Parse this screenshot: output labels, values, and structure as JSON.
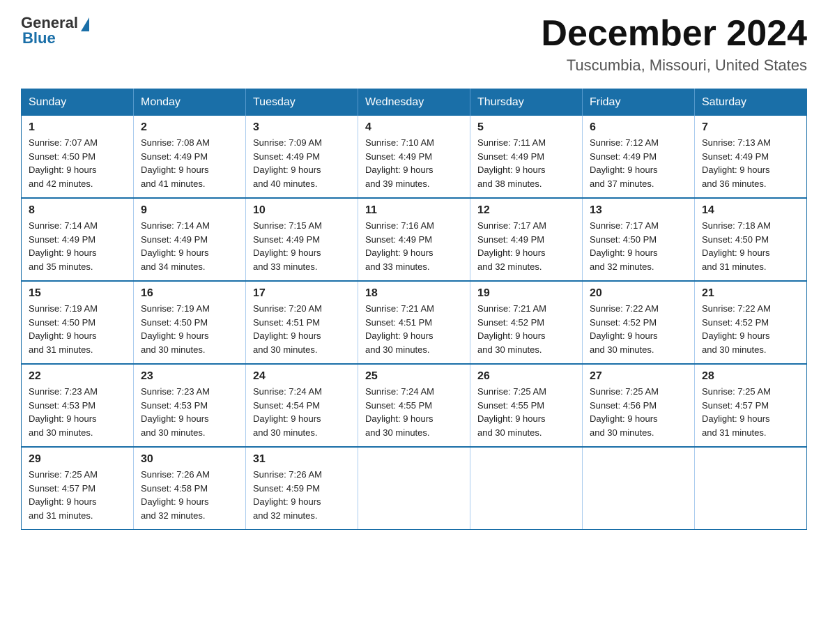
{
  "header": {
    "logo_general": "General",
    "logo_blue": "Blue",
    "month_title": "December 2024",
    "location": "Tuscumbia, Missouri, United States"
  },
  "weekdays": [
    "Sunday",
    "Monday",
    "Tuesday",
    "Wednesday",
    "Thursday",
    "Friday",
    "Saturday"
  ],
  "weeks": [
    [
      {
        "day": "1",
        "sunrise": "7:07 AM",
        "sunset": "4:50 PM",
        "daylight": "9 hours and 42 minutes."
      },
      {
        "day": "2",
        "sunrise": "7:08 AM",
        "sunset": "4:49 PM",
        "daylight": "9 hours and 41 minutes."
      },
      {
        "day": "3",
        "sunrise": "7:09 AM",
        "sunset": "4:49 PM",
        "daylight": "9 hours and 40 minutes."
      },
      {
        "day": "4",
        "sunrise": "7:10 AM",
        "sunset": "4:49 PM",
        "daylight": "9 hours and 39 minutes."
      },
      {
        "day": "5",
        "sunrise": "7:11 AM",
        "sunset": "4:49 PM",
        "daylight": "9 hours and 38 minutes."
      },
      {
        "day": "6",
        "sunrise": "7:12 AM",
        "sunset": "4:49 PM",
        "daylight": "9 hours and 37 minutes."
      },
      {
        "day": "7",
        "sunrise": "7:13 AM",
        "sunset": "4:49 PM",
        "daylight": "9 hours and 36 minutes."
      }
    ],
    [
      {
        "day": "8",
        "sunrise": "7:14 AM",
        "sunset": "4:49 PM",
        "daylight": "9 hours and 35 minutes."
      },
      {
        "day": "9",
        "sunrise": "7:14 AM",
        "sunset": "4:49 PM",
        "daylight": "9 hours and 34 minutes."
      },
      {
        "day": "10",
        "sunrise": "7:15 AM",
        "sunset": "4:49 PM",
        "daylight": "9 hours and 33 minutes."
      },
      {
        "day": "11",
        "sunrise": "7:16 AM",
        "sunset": "4:49 PM",
        "daylight": "9 hours and 33 minutes."
      },
      {
        "day": "12",
        "sunrise": "7:17 AM",
        "sunset": "4:49 PM",
        "daylight": "9 hours and 32 minutes."
      },
      {
        "day": "13",
        "sunrise": "7:17 AM",
        "sunset": "4:50 PM",
        "daylight": "9 hours and 32 minutes."
      },
      {
        "day": "14",
        "sunrise": "7:18 AM",
        "sunset": "4:50 PM",
        "daylight": "9 hours and 31 minutes."
      }
    ],
    [
      {
        "day": "15",
        "sunrise": "7:19 AM",
        "sunset": "4:50 PM",
        "daylight": "9 hours and 31 minutes."
      },
      {
        "day": "16",
        "sunrise": "7:19 AM",
        "sunset": "4:50 PM",
        "daylight": "9 hours and 30 minutes."
      },
      {
        "day": "17",
        "sunrise": "7:20 AM",
        "sunset": "4:51 PM",
        "daylight": "9 hours and 30 minutes."
      },
      {
        "day": "18",
        "sunrise": "7:21 AM",
        "sunset": "4:51 PM",
        "daylight": "9 hours and 30 minutes."
      },
      {
        "day": "19",
        "sunrise": "7:21 AM",
        "sunset": "4:52 PM",
        "daylight": "9 hours and 30 minutes."
      },
      {
        "day": "20",
        "sunrise": "7:22 AM",
        "sunset": "4:52 PM",
        "daylight": "9 hours and 30 minutes."
      },
      {
        "day": "21",
        "sunrise": "7:22 AM",
        "sunset": "4:52 PM",
        "daylight": "9 hours and 30 minutes."
      }
    ],
    [
      {
        "day": "22",
        "sunrise": "7:23 AM",
        "sunset": "4:53 PM",
        "daylight": "9 hours and 30 minutes."
      },
      {
        "day": "23",
        "sunrise": "7:23 AM",
        "sunset": "4:53 PM",
        "daylight": "9 hours and 30 minutes."
      },
      {
        "day": "24",
        "sunrise": "7:24 AM",
        "sunset": "4:54 PM",
        "daylight": "9 hours and 30 minutes."
      },
      {
        "day": "25",
        "sunrise": "7:24 AM",
        "sunset": "4:55 PM",
        "daylight": "9 hours and 30 minutes."
      },
      {
        "day": "26",
        "sunrise": "7:25 AM",
        "sunset": "4:55 PM",
        "daylight": "9 hours and 30 minutes."
      },
      {
        "day": "27",
        "sunrise": "7:25 AM",
        "sunset": "4:56 PM",
        "daylight": "9 hours and 30 minutes."
      },
      {
        "day": "28",
        "sunrise": "7:25 AM",
        "sunset": "4:57 PM",
        "daylight": "9 hours and 31 minutes."
      }
    ],
    [
      {
        "day": "29",
        "sunrise": "7:25 AM",
        "sunset": "4:57 PM",
        "daylight": "9 hours and 31 minutes."
      },
      {
        "day": "30",
        "sunrise": "7:26 AM",
        "sunset": "4:58 PM",
        "daylight": "9 hours and 32 minutes."
      },
      {
        "day": "31",
        "sunrise": "7:26 AM",
        "sunset": "4:59 PM",
        "daylight": "9 hours and 32 minutes."
      },
      null,
      null,
      null,
      null
    ]
  ]
}
